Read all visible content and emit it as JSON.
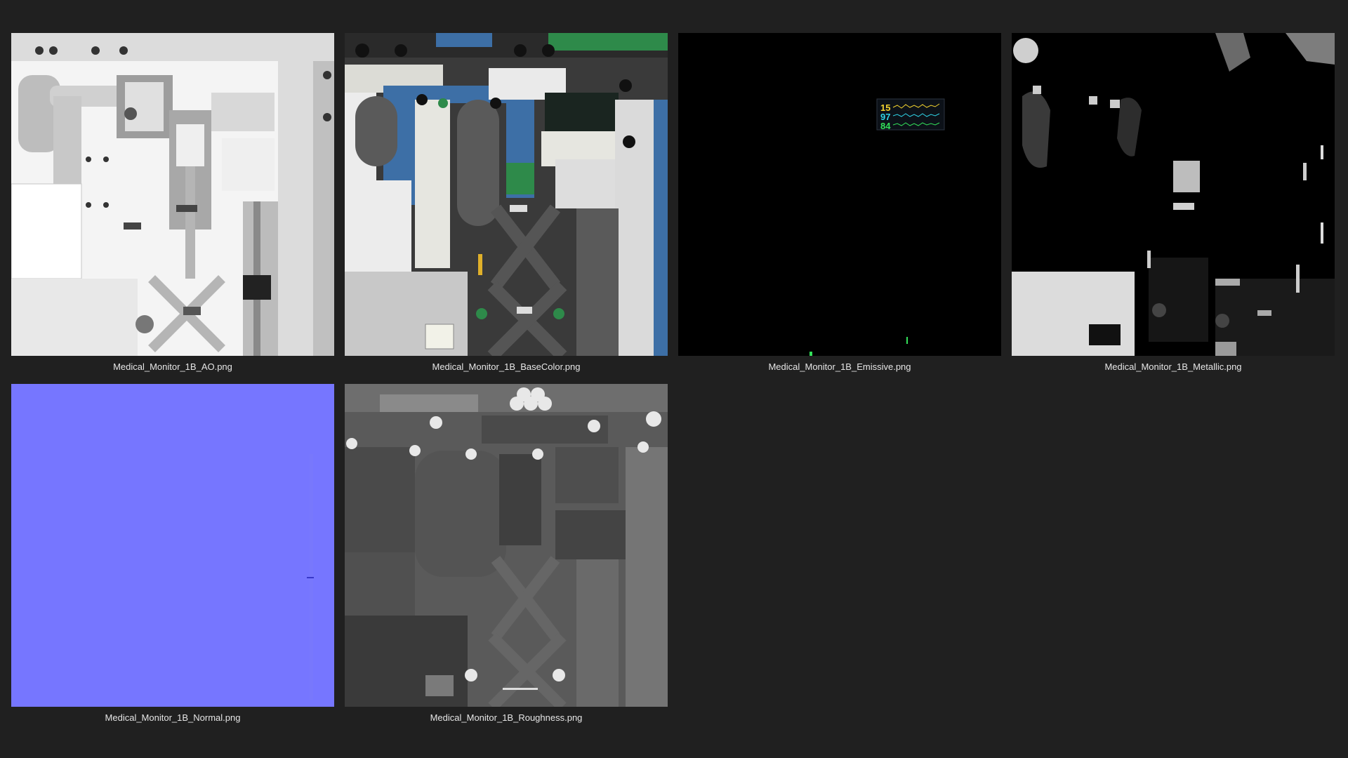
{
  "files": [
    {
      "name": "Medical_Monitor_1B_AO.png",
      "preview": "ambient-occlusion-map"
    },
    {
      "name": "Medical_Monitor_1B_BaseColor.png",
      "preview": "base-color-map"
    },
    {
      "name": "Medical_Monitor_1B_Emissive.png",
      "preview": "emissive-map"
    },
    {
      "name": "Medical_Monitor_1B_Metallic.png",
      "preview": "metallic-map"
    },
    {
      "name": "Medical_Monitor_1B_Normal.png",
      "preview": "normal-map"
    },
    {
      "name": "Medical_Monitor_1B_Roughness.png",
      "preview": "roughness-map"
    }
  ],
  "emissive_screen": {
    "readings": [
      "15",
      "97",
      "84"
    ],
    "colors": [
      "#f2d22e",
      "#2fd3e6",
      "#33e05a"
    ]
  },
  "colors": {
    "background": "#202020",
    "normal_map": "#7676ff",
    "base_blue": "#3d6fa6",
    "base_green": "#2e8a4a"
  }
}
